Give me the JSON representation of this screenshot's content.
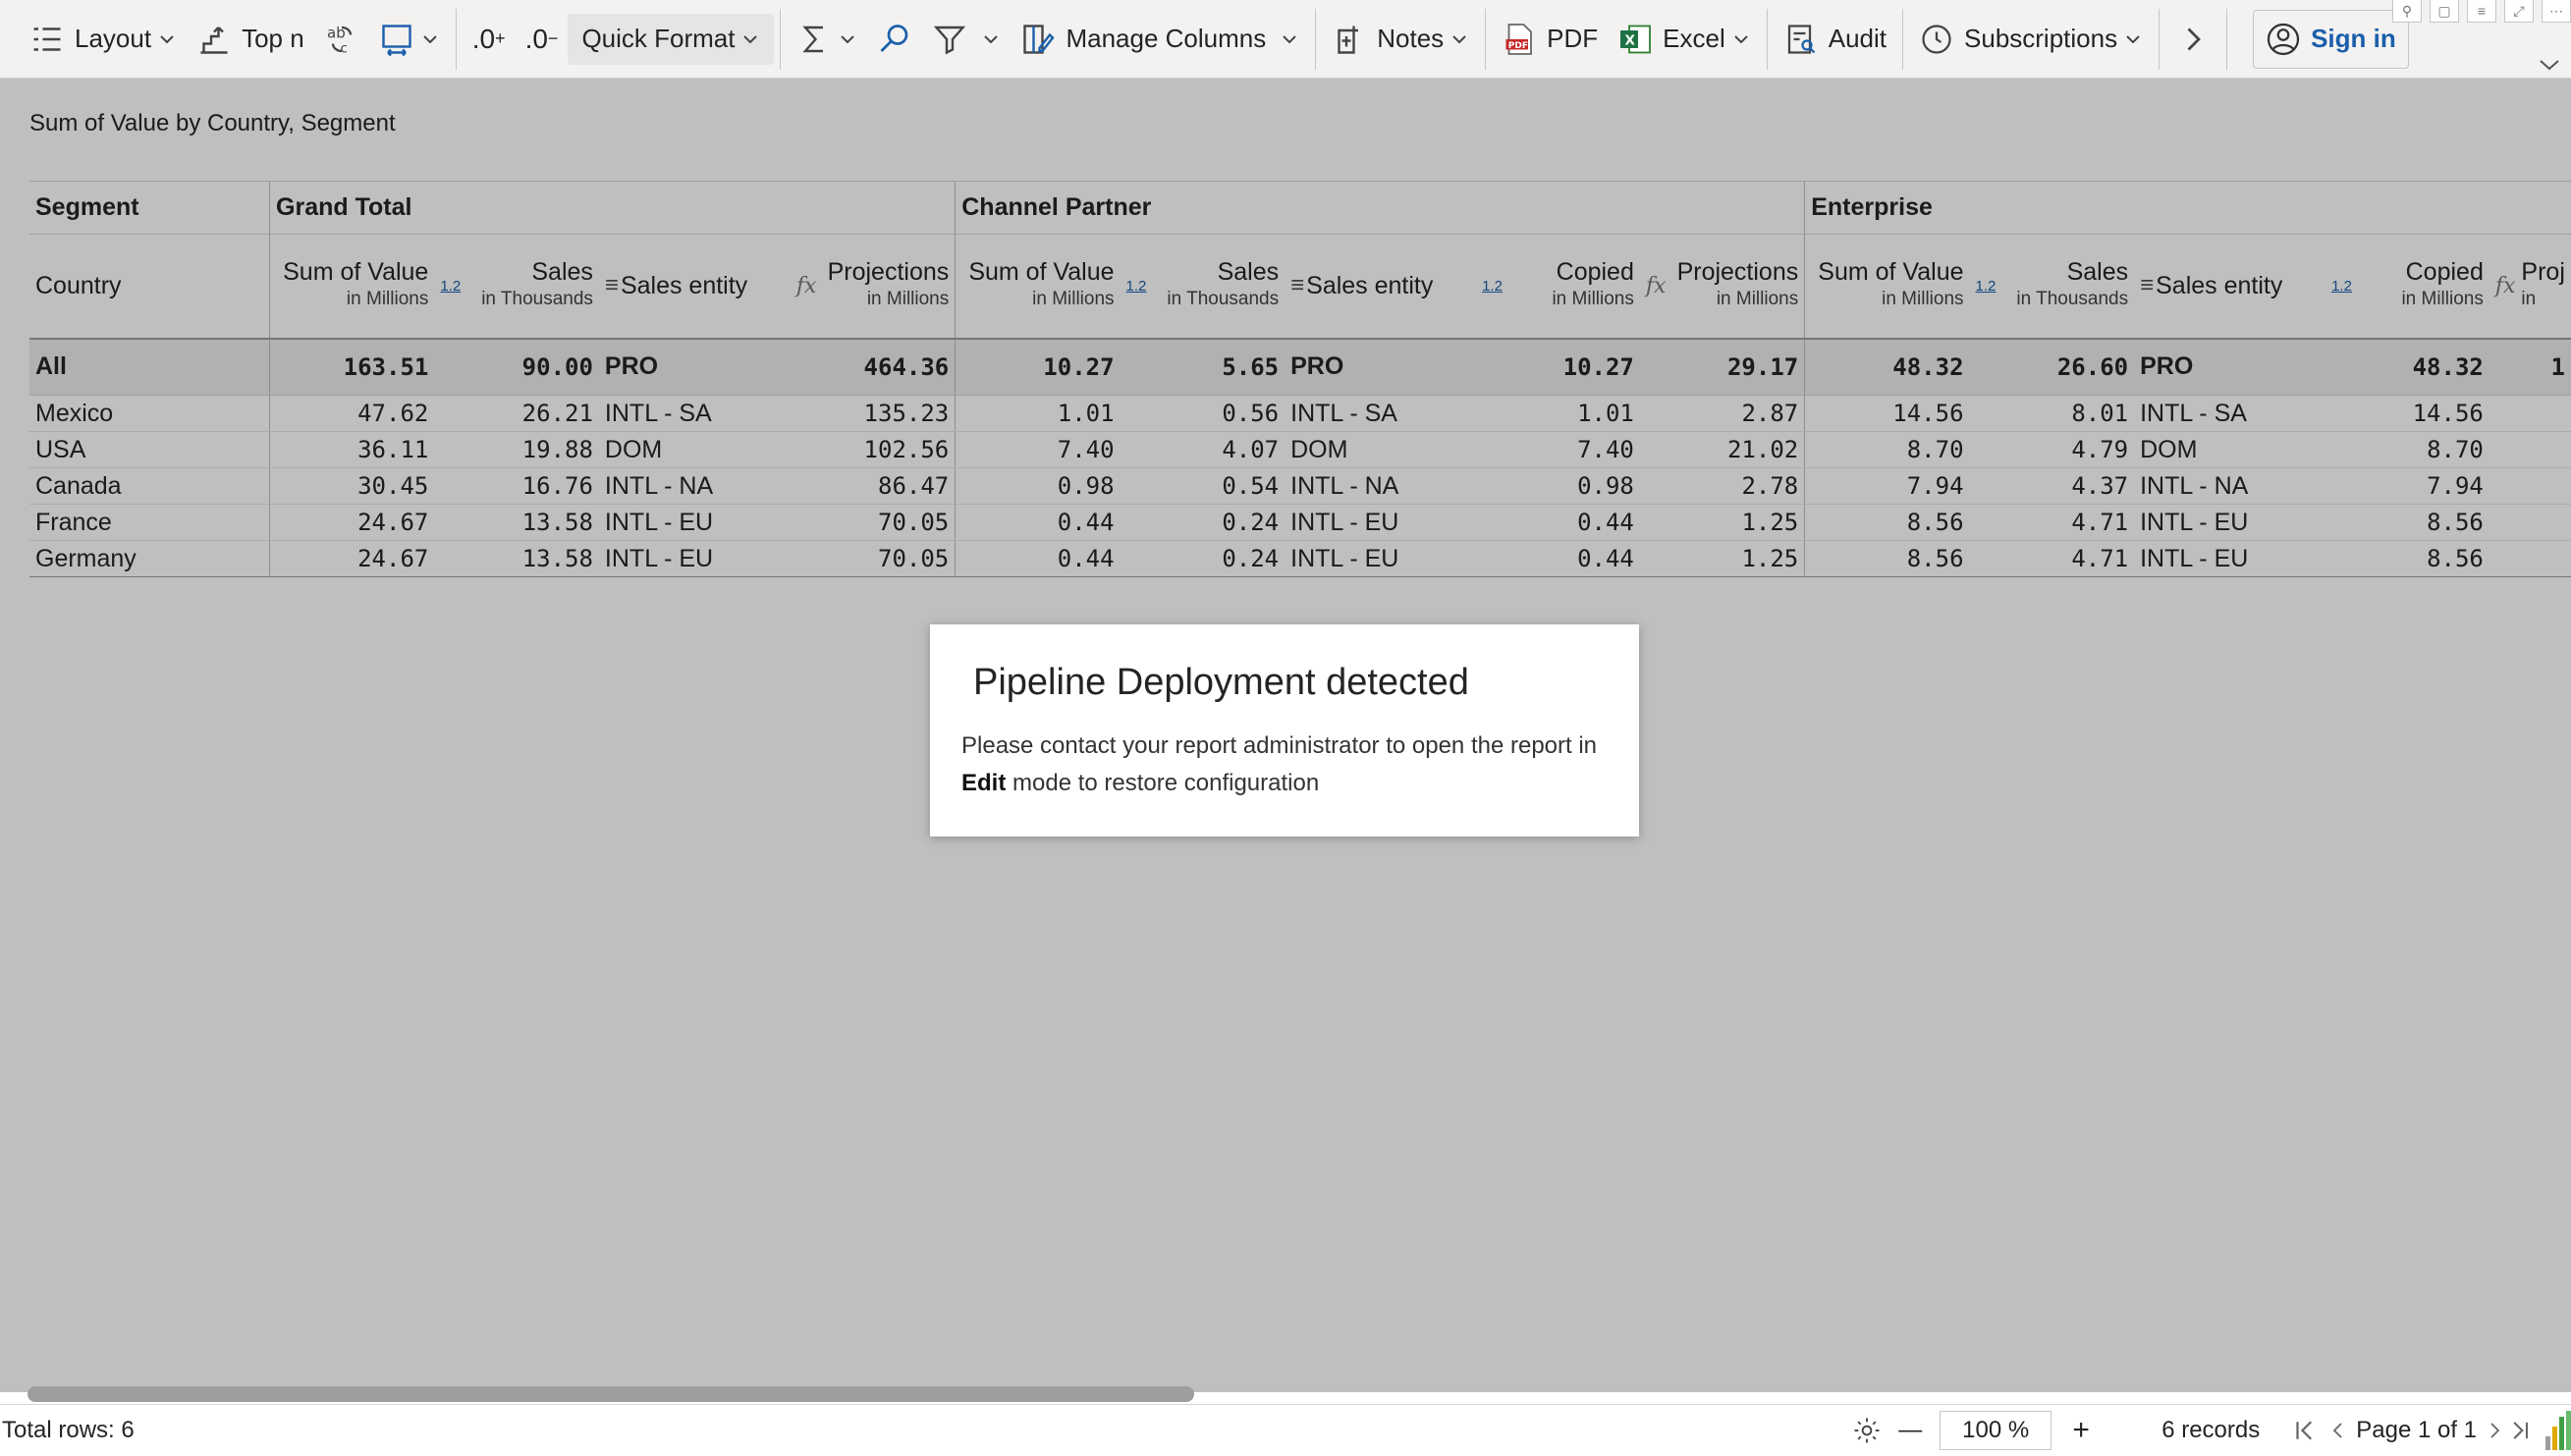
{
  "toolbar": {
    "layout_label": "Layout",
    "topn_label": "Top n",
    "quick_format_label": "Quick Format",
    "manage_columns_label": "Manage Columns",
    "notes_label": "Notes",
    "pdf_label": "PDF",
    "excel_label": "Excel",
    "audit_label": "Audit",
    "subscriptions_label": "Subscriptions",
    "signin_label": "Sign in",
    "dec_inc_label": ".0",
    "dec_dec_label": ".0"
  },
  "report": {
    "subtitle": "Sum of Value by Country, Segment",
    "segment_header": "Segment",
    "country_header": "Country",
    "groups": [
      "Grand Total",
      "Channel Partner",
      "Enterprise"
    ],
    "columns": {
      "sum_of_value": "Sum of Value",
      "sales": "Sales",
      "sales_entity": "Sales entity",
      "projections": "Projections",
      "copied": "Copied",
      "proj_cut": "Proj",
      "in_millions": "in Millions",
      "in_thousands": "in Thousands",
      "in_cut": "in",
      "icon_12": "1.2",
      "icon_fx": "fx",
      "icon_eq": "≡"
    },
    "rows": [
      {
        "country": "All",
        "gt": [
          "163.51",
          "90.00",
          "PRO",
          "464.36"
        ],
        "cp": [
          "10.27",
          "5.65",
          "PRO",
          "10.27",
          "29.17"
        ],
        "ent": [
          "48.32",
          "26.60",
          "PRO",
          "48.32"
        ],
        "cut": "1"
      },
      {
        "country": "Mexico",
        "gt": [
          "47.62",
          "26.21",
          "INTL - SA",
          "135.23"
        ],
        "cp": [
          "1.01",
          "0.56",
          "INTL - SA",
          "1.01",
          "2.87"
        ],
        "ent": [
          "14.56",
          "8.01",
          "INTL - SA",
          "14.56"
        ],
        "cut": ""
      },
      {
        "country": "USA",
        "gt": [
          "36.11",
          "19.88",
          "DOM",
          "102.56"
        ],
        "cp": [
          "7.40",
          "4.07",
          "DOM",
          "7.40",
          "21.02"
        ],
        "ent": [
          "8.70",
          "4.79",
          "DOM",
          "8.70"
        ],
        "cut": ""
      },
      {
        "country": "Canada",
        "gt": [
          "30.45",
          "16.76",
          "INTL - NA",
          "86.47"
        ],
        "cp": [
          "0.98",
          "0.54",
          "INTL - NA",
          "0.98",
          "2.78"
        ],
        "ent": [
          "7.94",
          "4.37",
          "INTL - NA",
          "7.94"
        ],
        "cut": ""
      },
      {
        "country": "France",
        "gt": [
          "24.67",
          "13.58",
          "INTL - EU",
          "70.05"
        ],
        "cp": [
          "0.44",
          "0.24",
          "INTL - EU",
          "0.44",
          "1.25"
        ],
        "ent": [
          "8.56",
          "4.71",
          "INTL - EU",
          "8.56"
        ],
        "cut": ""
      },
      {
        "country": "Germany",
        "gt": [
          "24.67",
          "13.58",
          "INTL - EU",
          "70.05"
        ],
        "cp": [
          "0.44",
          "0.24",
          "INTL - EU",
          "0.44",
          "1.25"
        ],
        "ent": [
          "8.56",
          "4.71",
          "INTL - EU",
          "8.56"
        ],
        "cut": ""
      }
    ]
  },
  "dialog": {
    "title": "Pipeline Deployment detected",
    "body_prefix": "Please contact your report administrator to open the report in",
    "body_bold": "Edit",
    "body_suffix": "mode to restore configuration"
  },
  "footer": {
    "total_rows": "Total rows: 6",
    "zoom_value": "100 %",
    "records": "6 records",
    "page_label": "Page 1 of 1",
    "zoom_minus": "—",
    "zoom_plus": "+"
  }
}
